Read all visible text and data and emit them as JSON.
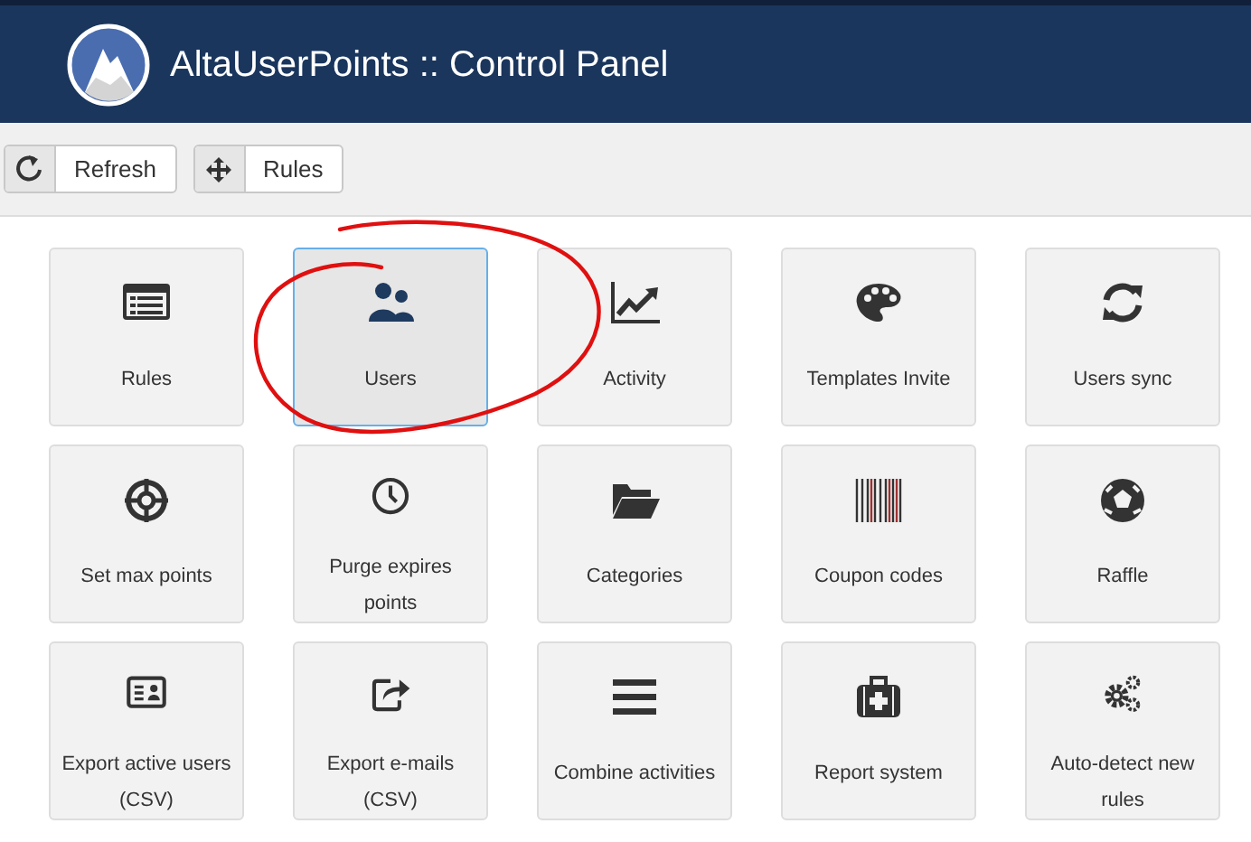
{
  "header": {
    "title": "AltaUserPoints :: Control Panel"
  },
  "toolbar": [
    {
      "label": "Refresh"
    },
    {
      "label": "Rules"
    }
  ],
  "tiles": [
    {
      "label": "Rules",
      "selected": false
    },
    {
      "label": "Users",
      "selected": true
    },
    {
      "label": "Activity",
      "selected": false
    },
    {
      "label": "Templates Invite",
      "selected": false
    },
    {
      "label": "Users sync",
      "selected": false
    },
    {
      "label": "Set max points",
      "selected": false
    },
    {
      "label": "Purge expires points",
      "selected": false
    },
    {
      "label": "Categories",
      "selected": false
    },
    {
      "label": "Coupon codes",
      "selected": false
    },
    {
      "label": "Raffle",
      "selected": false
    },
    {
      "label": "Export active users (CSV)",
      "selected": false
    },
    {
      "label": "Export e-mails (CSV)",
      "selected": false
    },
    {
      "label": "Combine activities",
      "selected": false
    },
    {
      "label": "Report system",
      "selected": false
    },
    {
      "label": "Auto-detect new rules",
      "selected": false
    }
  ]
}
